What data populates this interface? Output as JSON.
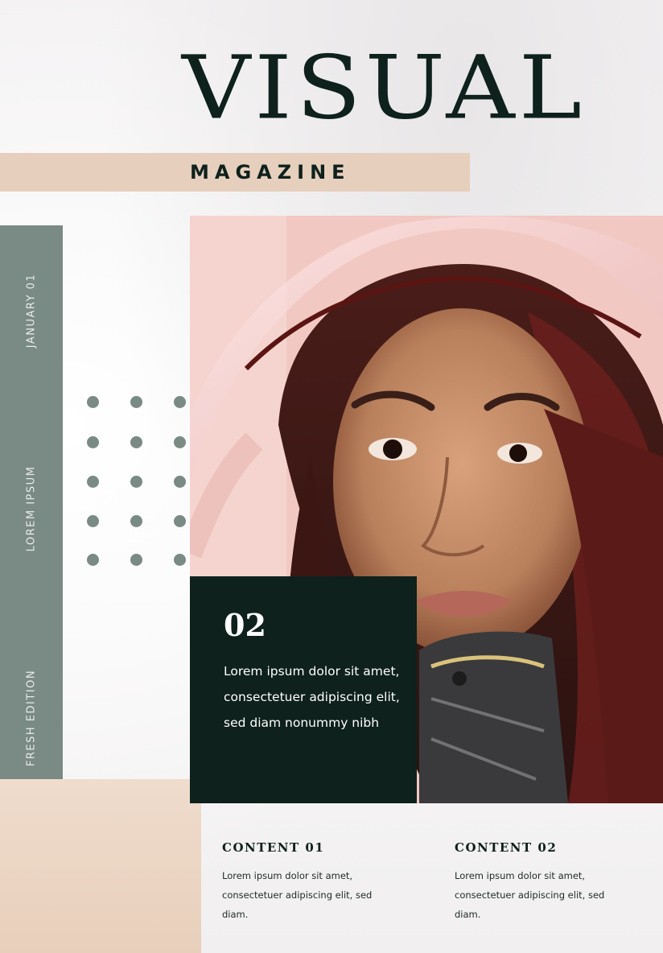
{
  "masthead": {
    "title": "VISUAL",
    "subtitle": "MAGAZINE"
  },
  "sidebar": {
    "labels": [
      "JANUARY 01",
      "LOREM IPSUM",
      "FRESH EDITION"
    ]
  },
  "feature": {
    "number": "02",
    "text": "Lorem ipsum dolor sit amet, consectetuer adipiscing elit, sed diam nonummy nibh"
  },
  "contents": [
    {
      "heading": "CONTENT 01",
      "text": "Lorem ipsum dolor sit amet, consectetuer adipiscing elit, sed diam."
    },
    {
      "heading": "CONTENT 02",
      "text": "Lorem ipsum dolor sit amet, consectetuer adipiscing elit, sed diam."
    }
  ],
  "colors": {
    "dark_green": "#0e211c",
    "sage": "#7a8a85",
    "beige": "#e6cfbd",
    "background": "#f3f1f1"
  }
}
